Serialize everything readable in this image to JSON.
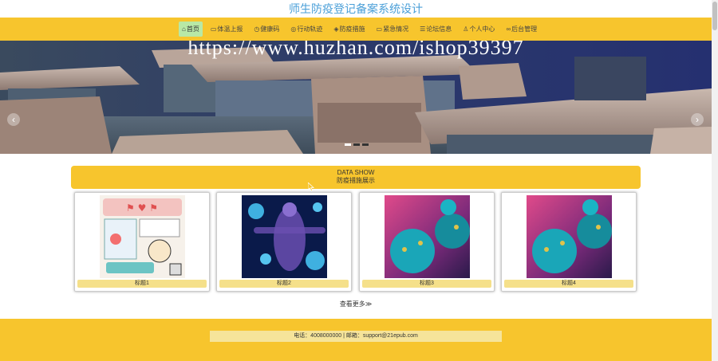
{
  "app": {
    "title": "师生防疫登记备案系统设计"
  },
  "nav": {
    "items": [
      {
        "label": "首页",
        "icon": "home-icon",
        "glyph": "⌂",
        "active": true
      },
      {
        "label": "体温上报",
        "icon": "report-icon",
        "glyph": "▭",
        "active": false
      },
      {
        "label": "健康码",
        "icon": "clock-icon",
        "glyph": "◷",
        "active": false
      },
      {
        "label": "行动轨迹",
        "icon": "compass-icon",
        "glyph": "◎",
        "active": false
      },
      {
        "label": "防疫措施",
        "icon": "shield-icon",
        "glyph": "◈",
        "active": false
      },
      {
        "label": "紧急情况",
        "icon": "alert-icon",
        "glyph": "▭",
        "active": false
      },
      {
        "label": "论坛信息",
        "icon": "forum-icon",
        "glyph": "☰",
        "active": false
      },
      {
        "label": "个人中心",
        "icon": "user-icon",
        "glyph": "♙",
        "active": false
      },
      {
        "label": "后台管理",
        "icon": "link-icon",
        "glyph": "∞",
        "active": false
      }
    ]
  },
  "banner": {
    "watermark": "https://www.huzhan.com/ishop39397",
    "prev_glyph": "‹",
    "next_glyph": "›",
    "slides": 3,
    "active_slide": 1
  },
  "section": {
    "title_en": "DATA SHOW",
    "title_cn": "防疫措施展示"
  },
  "cards": [
    {
      "caption": "标题1",
      "image": "poster-image"
    },
    {
      "caption": "标题2",
      "image": "virus-body-image"
    },
    {
      "caption": "标题3",
      "image": "virus-image"
    },
    {
      "caption": "标题4",
      "image": "virus-image"
    }
  ],
  "more": {
    "label": "查看更多",
    "glyph": "≫"
  },
  "footer": {
    "contact": "电话：4008000000 | 邮箱：support@21epub.com"
  },
  "colors": {
    "accent": "#f7c52d",
    "title": "#4a9fd8",
    "caption_bg": "#f5e08a"
  }
}
